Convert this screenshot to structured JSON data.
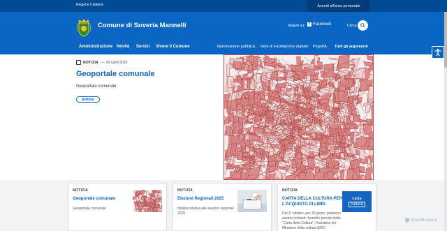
{
  "topbar": {
    "region": "Regione Calabria",
    "login": "Accedi all'area personale"
  },
  "header": {
    "title": "Comune di Soveria Mannelli",
    "follow_label": "Seguici su:",
    "facebook_label": "Facebook",
    "search_label": "Cerca"
  },
  "nav": {
    "main": [
      "Amministrazione",
      "Novità",
      "Servizi",
      "Vivere il Comune"
    ],
    "secondary": [
      "Illuminazione pubblica",
      "Rete di Facilitazione digitale",
      "PagoPA",
      "Tutti gli argomenti"
    ]
  },
  "hero": {
    "tag": "NOTIZIA",
    "date": "09 GEN 2026",
    "title": "Geoportale comunale",
    "description": "Geoportale comunale",
    "chip": "Edilizia"
  },
  "cards": [
    {
      "tag": "NOTIZIA",
      "title": "Geoportale comunale",
      "text": "Geoportale comunale"
    },
    {
      "tag": "NOTIZIA",
      "title": "Elezioni Regionali 2025",
      "text": "Notizia relativa alle elezioni regionali 2025"
    },
    {
      "tag": "NOTIZIA",
      "title": "CARTA DELLA CULTURA PER L'ACQUISTO DI LIBRI",
      "text": "Dal 1° ottobre, per 30 giorni, potranno essere richiesti i benefici previsti dalla \"Carta della Cultura\", l'iniziativa del Ministero della cultura (MiC)",
      "badge_line1": "carta",
      "badge_line2": "cultura"
    }
  ],
  "watermark": "ScanMalware",
  "colors": {
    "primary": "#0a66c2",
    "topbar": "#004a93",
    "map_red": "#c0392b"
  }
}
